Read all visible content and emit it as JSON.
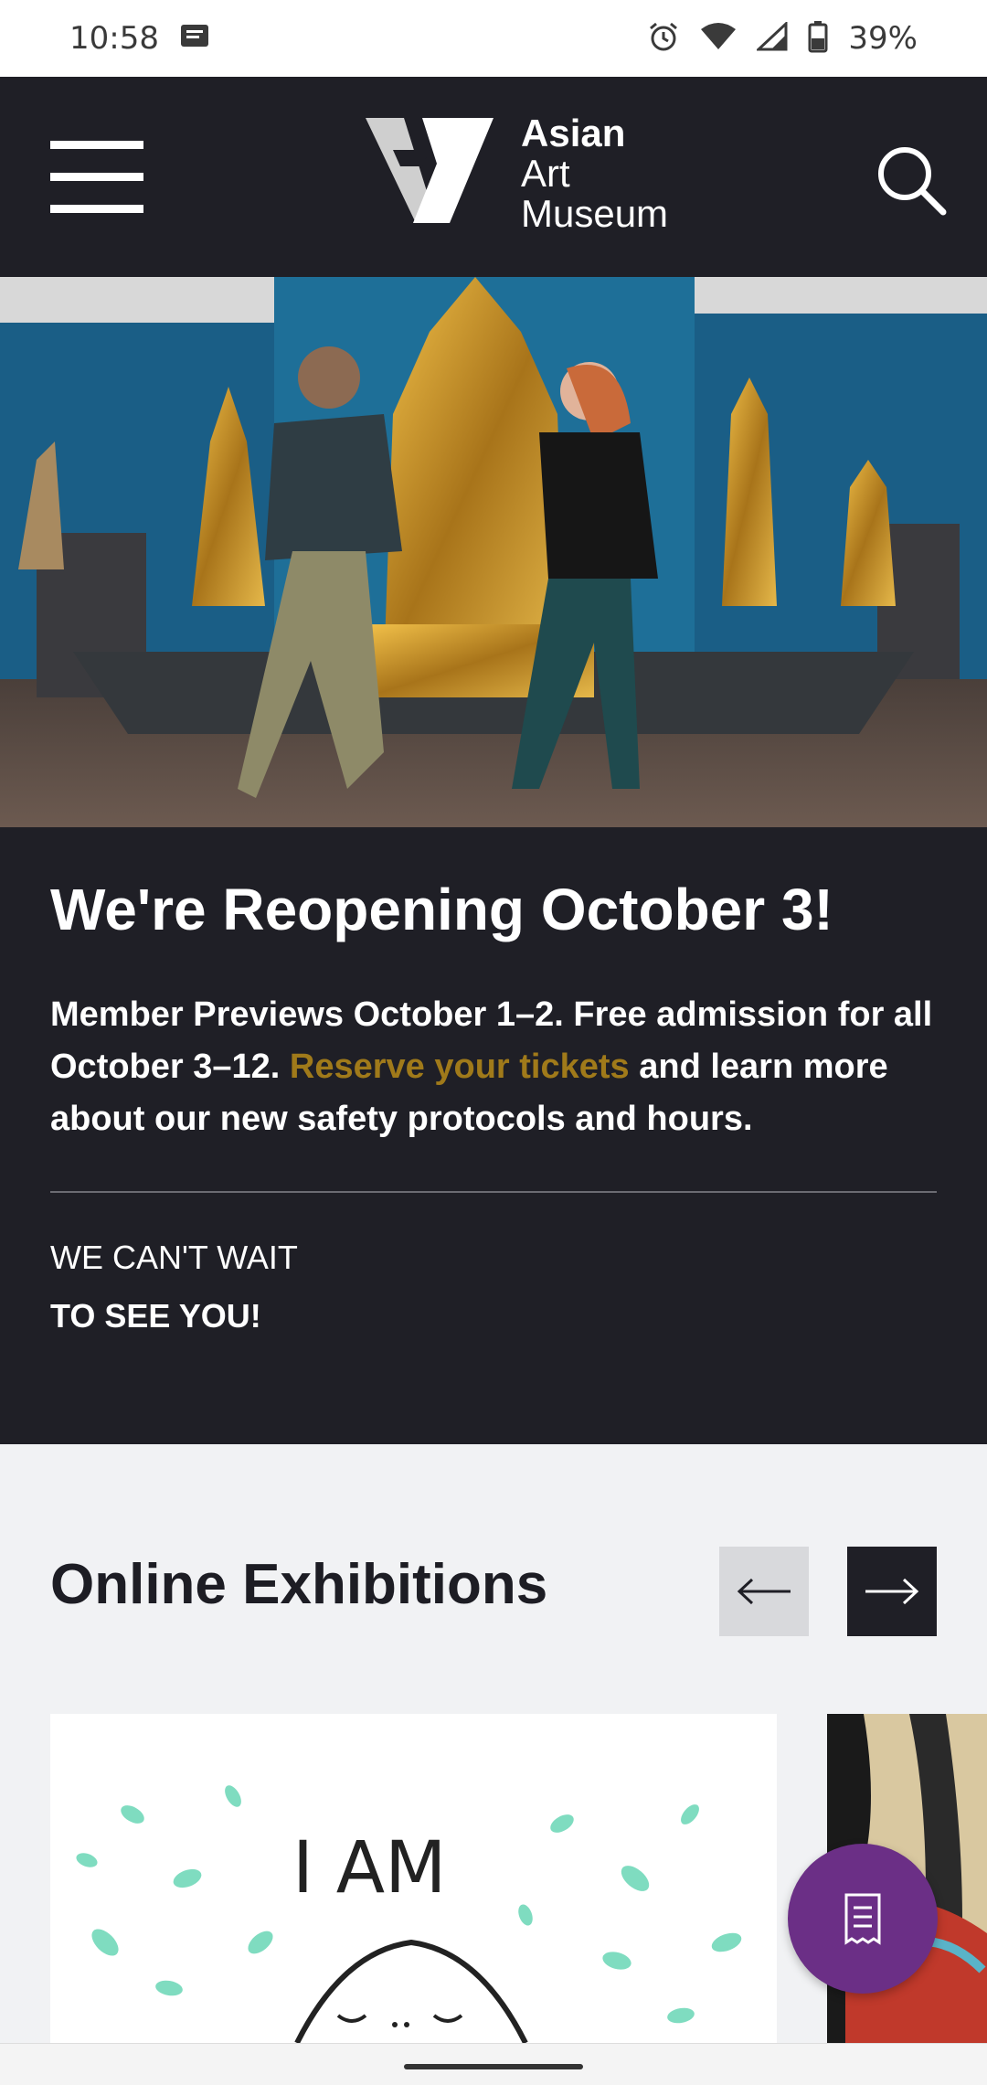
{
  "status_bar": {
    "time": "10:58",
    "battery_percent": "39%",
    "icons": [
      "message-icon",
      "alarm-icon",
      "wifi-icon",
      "signal-icon",
      "battery-icon"
    ]
  },
  "header": {
    "logo": {
      "line1": "Asian",
      "line2": "Art",
      "line3": "Museum"
    },
    "menu_icon": "hamburger-menu-icon",
    "search_icon": "search-icon"
  },
  "announcement": {
    "title": "We're Reopening October 3!",
    "body_before": "Member Previews October 1–2. Free admission for all October 3–12.",
    "link_text": "Reserve your tickets",
    "body_after": "and learn more about our new safety protocols and hours.",
    "kicker_line1": "WE CAN'T WAIT",
    "kicker_line2": "TO SEE YOU!"
  },
  "exhibitions": {
    "title": "Online Exhibitions",
    "prev_icon": "arrow-left-icon",
    "next_icon": "arrow-right-icon",
    "card1_text": "I AM"
  },
  "fab": {
    "icon": "ticket-icon"
  },
  "colors": {
    "dark": "#1f1f26",
    "link": "#a07a1a",
    "fab": "#6b2f86",
    "bg": "#f1f2f4"
  }
}
